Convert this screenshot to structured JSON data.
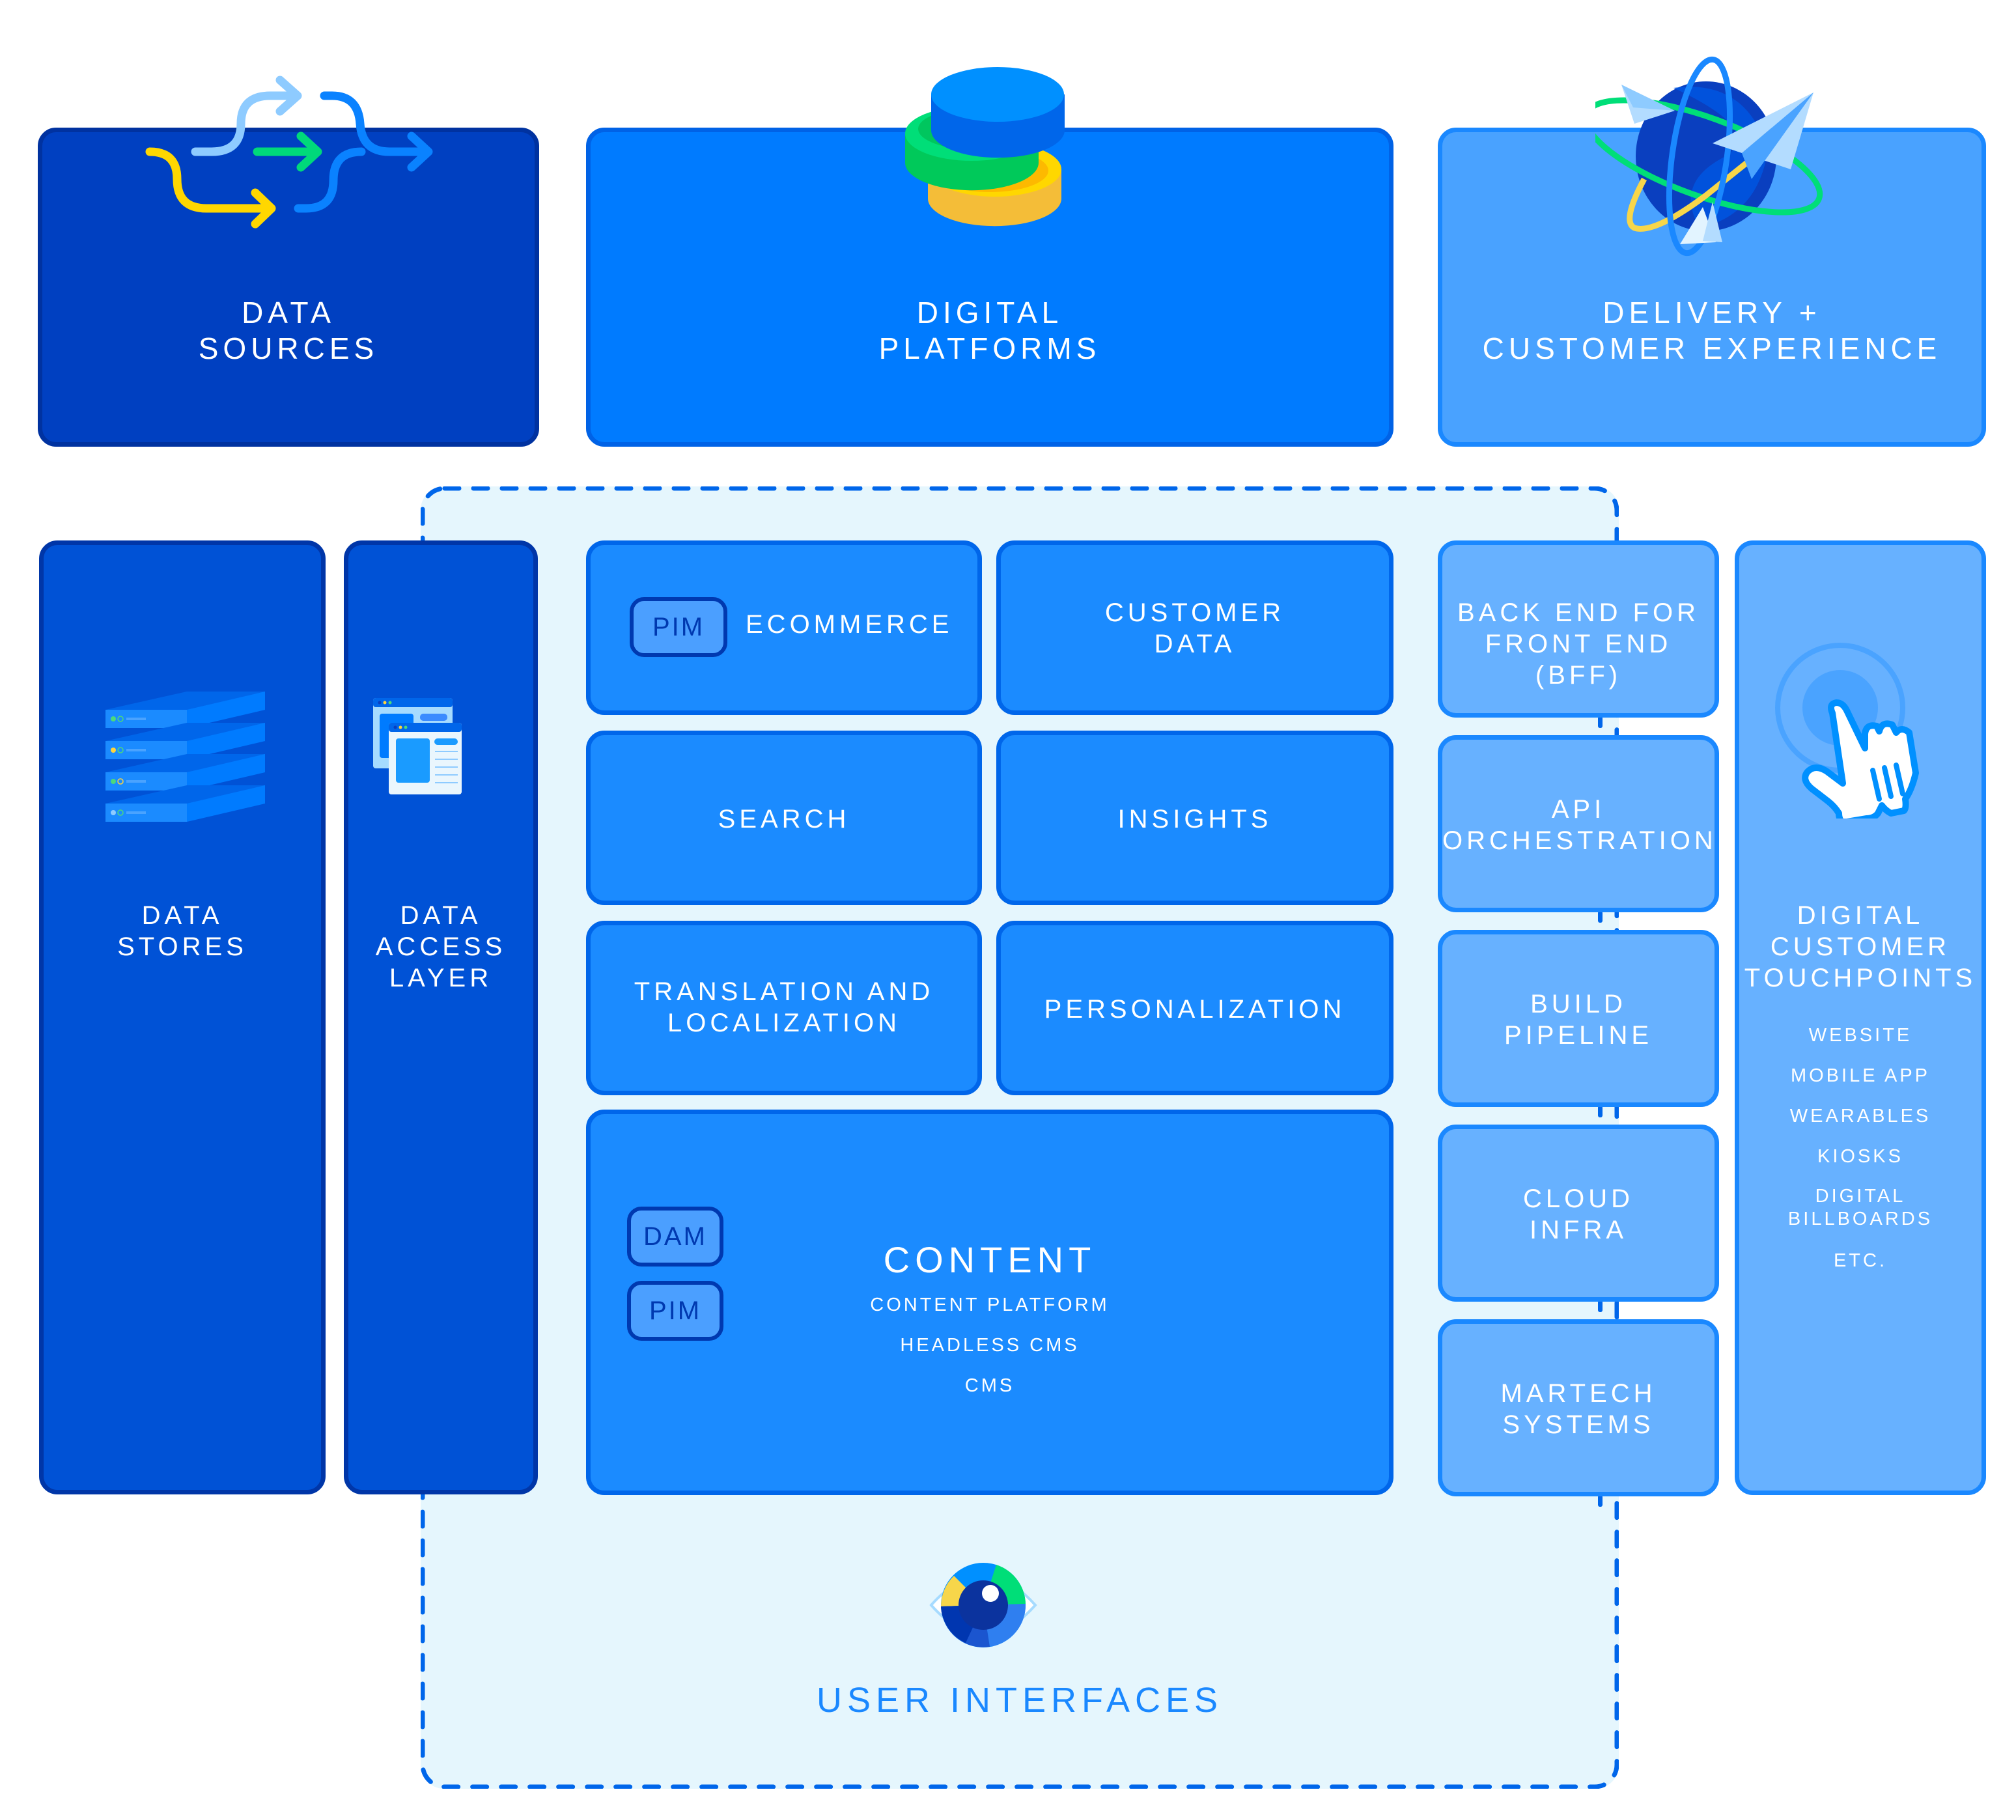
{
  "top_row": {
    "data_sources": {
      "title": "DATA\nSOURCES",
      "icon": "flow-arrows-icon"
    },
    "digital_platforms": {
      "title": "DIGITAL\nPLATFORMS",
      "icon": "stacked-discs-icon"
    },
    "delivery": {
      "title": "DELIVERY +\nCUSTOMER EXPERIENCE",
      "icon": "globe-paper-planes-icon"
    }
  },
  "left_columns": {
    "data_stores": {
      "title": "DATA\nSTORES",
      "icon": "server-stack-icon"
    },
    "data_access_layer": {
      "title": "DATA\nACCESS\nLAYER",
      "icon": "browser-windows-icon"
    }
  },
  "platform_grid": {
    "ecommerce": {
      "tag": "PIM",
      "title": "ECOMMERCE"
    },
    "customer_data": {
      "title": "CUSTOMER\nDATA"
    },
    "search": {
      "title": "SEARCH"
    },
    "insights": {
      "title": "INSIGHTS"
    },
    "translation": {
      "title": "TRANSLATION AND\nLOCALIZATION"
    },
    "personalization": {
      "title": "PERSONALIZATION"
    },
    "content": {
      "tags": [
        "DAM",
        "PIM"
      ],
      "title": "CONTENT",
      "items": [
        "CONTENT PLATFORM",
        "HEADLESS CMS",
        "CMS"
      ]
    }
  },
  "delivery_stack": [
    {
      "title": "BACK END FOR\nFRONT END (BFF)"
    },
    {
      "title": "API\nORCHESTRATION"
    },
    {
      "title": "BUILD\nPIPELINE"
    },
    {
      "title": "CLOUD\nINFRA"
    },
    {
      "title": "MARTECH\nSYSTEMS"
    }
  ],
  "touchpoints": {
    "title": "DIGITAL\nCUSTOMER\nTOUCHPOINTS",
    "icon": "pointing-hand-tap-icon",
    "items": [
      "WEBSITE",
      "MOBILE APP",
      "WEARABLES",
      "KIOSKS",
      "DIGITAL\nBILLBOARDS",
      "ETC."
    ]
  },
  "user_interfaces": {
    "title": "USER INTERFACES",
    "icon": "eye-icon"
  },
  "colors": {
    "dark_navy": "#0040c1",
    "primary_blue": "#007bff",
    "cell_blue": "#1b8bff",
    "light_blue": "#49a2ff",
    "lighter_blue": "#67b1ff",
    "frame_bg": "#e5f6fd",
    "dash_blue": "#0066ea",
    "accent_yellow": "#ffd700",
    "accent_green": "#00d97a"
  }
}
